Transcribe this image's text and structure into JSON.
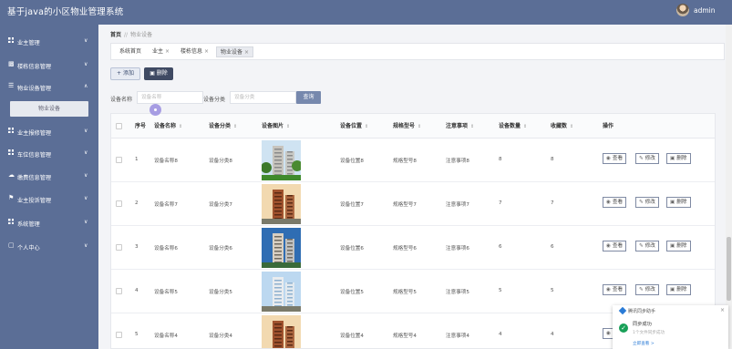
{
  "app": {
    "title": "基于java的小区物业管理系统",
    "user": "admin"
  },
  "sidebar": {
    "items": [
      {
        "label": "业主管理",
        "icon": "grid-icon",
        "chevron": "∨"
      },
      {
        "label": "楼栋信息管理",
        "icon": "chat-icon",
        "chevron": "∨"
      },
      {
        "label": "物业设备管理",
        "icon": "list-icon",
        "chevron": "∧"
      },
      {
        "label": "业主报修管理",
        "icon": "grid-icon",
        "chevron": "∨"
      },
      {
        "label": "车位信息管理",
        "icon": "grid-icon",
        "chevron": "∨"
      },
      {
        "label": "缴费信息管理",
        "icon": "cloud-icon",
        "chevron": "∨"
      },
      {
        "label": "业主投诉管理",
        "icon": "flag-icon",
        "chevron": "∨"
      },
      {
        "label": "系统管理",
        "icon": "grid-icon",
        "chevron": "∨"
      },
      {
        "label": "个人中心",
        "icon": "window-icon",
        "chevron": "∨"
      }
    ],
    "submenu": {
      "label": "物业设备"
    }
  },
  "breadcrumb": {
    "home": "首页",
    "separator": "//",
    "current": "物业设备"
  },
  "tabs": [
    {
      "label": "系统首页",
      "closable": false
    },
    {
      "label": "业主",
      "closable": true
    },
    {
      "label": "楼栋信息",
      "closable": true
    },
    {
      "label": "物业设备",
      "closable": true
    }
  ],
  "tab_close": "×",
  "toolbar": {
    "add": "+ 添加",
    "delete": "删除"
  },
  "filters": {
    "name_label": "设备名称",
    "name_placeholder": "设备名称",
    "category_label": "设备分类",
    "category_placeholder": "设备分类",
    "search": "查询"
  },
  "table": {
    "headers": [
      "序号",
      "设备名称",
      "设备分类",
      "设备图片",
      "设备位置",
      "规格型号",
      "注意事项",
      "设备数量",
      "收藏数",
      "操作"
    ],
    "sort_glyph": "⇕",
    "rows": [
      {
        "index": "1",
        "name": "设备名称8",
        "category": "设备分类8",
        "location": "设备位置8",
        "model": "规格型号8",
        "notes": "注意事项8",
        "qty": "8",
        "favs": "8",
        "image": "tower-green"
      },
      {
        "index": "2",
        "name": "设备名称7",
        "category": "设备分类7",
        "location": "设备位置7",
        "model": "规格型号7",
        "notes": "注意事项7",
        "qty": "7",
        "favs": "7",
        "image": "tower-warm"
      },
      {
        "index": "3",
        "name": "设备名称6",
        "category": "设备分类6",
        "location": "设备位置6",
        "model": "规格型号6",
        "notes": "注意事项6",
        "qty": "6",
        "favs": "6",
        "image": "tower-blue"
      },
      {
        "index": "4",
        "name": "设备名称5",
        "category": "设备分类5",
        "location": "设备位置5",
        "model": "规格型号5",
        "notes": "注意事项5",
        "qty": "5",
        "favs": "5",
        "image": "tower-white"
      },
      {
        "index": "5",
        "name": "设备名称4",
        "category": "设备分类4",
        "location": "设备位置4",
        "model": "规格型号4",
        "notes": "注意事项4",
        "qty": "4",
        "favs": "4",
        "image": "tower-warm"
      }
    ],
    "actions": {
      "view": "查看",
      "edit": "修改",
      "delete": "删除"
    }
  },
  "toast": {
    "app": "腾讯同步助手",
    "title": "同步成功",
    "message": "1个文件同步成功",
    "link": "立即查看 >",
    "close": "×"
  },
  "colors": {
    "header": "#5b6e96",
    "sidebar": "#5b6e96",
    "delete_button": "#3f4a63",
    "search_button": "#7688ad",
    "success": "#18a058",
    "link": "#2a7bd6"
  }
}
